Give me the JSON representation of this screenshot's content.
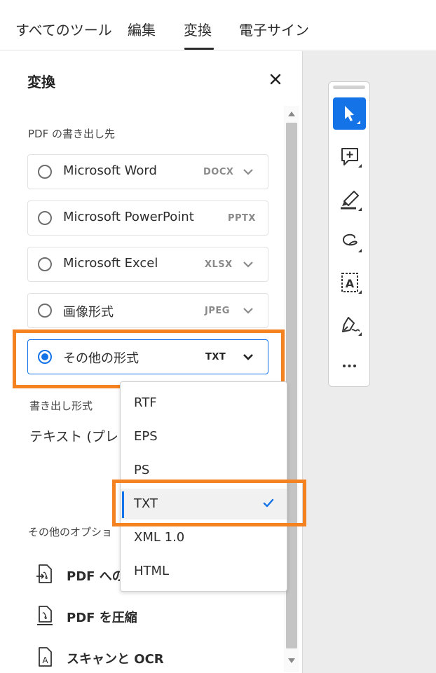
{
  "tabs": [
    {
      "label": "すべてのツール"
    },
    {
      "label": "編集"
    },
    {
      "label": "変換",
      "active": true
    },
    {
      "label": "電子サイン"
    }
  ],
  "panel": {
    "title": "変換",
    "export_label": "PDF の書き出し先",
    "options": [
      {
        "label": "Microsoft Word",
        "ext": "DOCX",
        "has_dropdown": true,
        "selected": false
      },
      {
        "label": "Microsoft PowerPoint",
        "ext": "PPTX",
        "has_dropdown": false,
        "selected": false
      },
      {
        "label": "Microsoft Excel",
        "ext": "XLSX",
        "has_dropdown": true,
        "selected": false
      },
      {
        "label": "画像形式",
        "ext": "JPEG",
        "has_dropdown": true,
        "selected": false
      },
      {
        "label": "その他の形式",
        "ext": "TXT",
        "has_dropdown": true,
        "selected": true
      }
    ],
    "format_label": "書き出し形式",
    "format_value": "テキスト (プレ",
    "more_options_label": "その他のオプショ",
    "more_items": [
      {
        "label": "PDF への",
        "icon": "convert-to-pdf-icon"
      },
      {
        "label": "PDF を圧縮",
        "icon": "compress-pdf-icon"
      },
      {
        "label": "スキャンと OCR",
        "icon": "scan-ocr-icon"
      }
    ]
  },
  "dropdown": {
    "items": [
      "RTF",
      "EPS",
      "PS",
      "TXT",
      "XML 1.0",
      "HTML"
    ],
    "selected": "TXT"
  },
  "colors": {
    "accent": "#1473e6",
    "highlight": "#f58220",
    "canvas": "#ececec"
  },
  "toolbar": {
    "tools": [
      "select-pointer-icon",
      "add-comment-icon",
      "highlight-pen-icon",
      "freehand-draw-icon",
      "text-box-icon",
      "sign-icon",
      "more-tools-icon"
    ]
  }
}
